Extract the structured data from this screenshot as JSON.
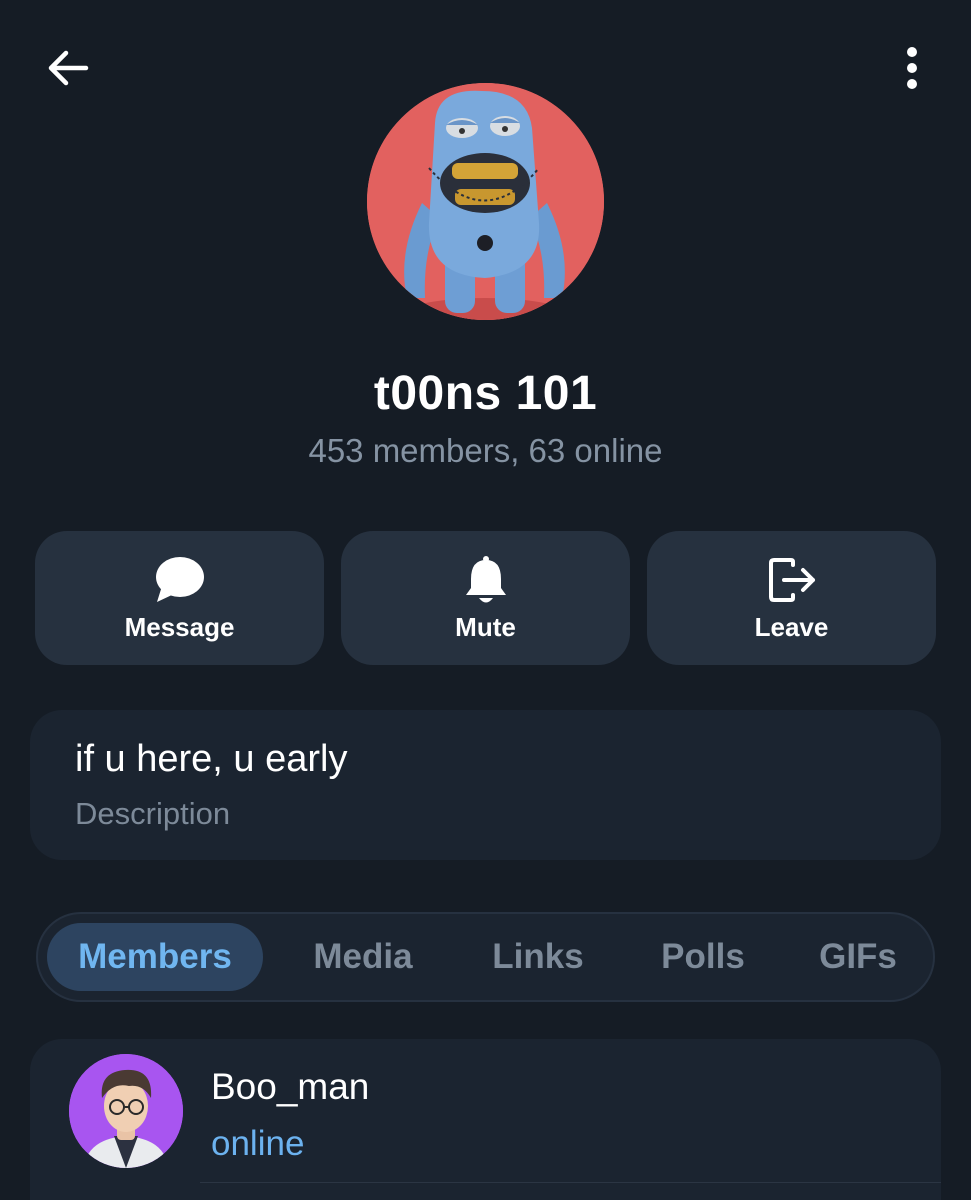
{
  "header": {
    "back_icon": "arrow-left-icon",
    "more_icon": "more-vertical-icon"
  },
  "group": {
    "avatar": "clay-monster-avatar",
    "title": "t00ns 101",
    "subtitle": "453 members, 63 online"
  },
  "actions": [
    {
      "label": "Message",
      "icon": "chat-bubble-icon"
    },
    {
      "label": "Mute",
      "icon": "bell-icon"
    },
    {
      "label": "Leave",
      "icon": "leave-icon"
    }
  ],
  "description": {
    "text": "if u here, u early",
    "label": "Description"
  },
  "tabs": [
    {
      "label": "Members",
      "active": true
    },
    {
      "label": "Media",
      "active": false
    },
    {
      "label": "Links",
      "active": false
    },
    {
      "label": "Polls",
      "active": false
    },
    {
      "label": "GIFs",
      "active": false
    }
  ],
  "members": [
    {
      "name": "Boo_man",
      "status": "online",
      "avatar": "cartoon-boy-avatar"
    }
  ],
  "colors": {
    "background": "#151c25",
    "card": "#1b2430",
    "button": "#26313f",
    "accent": "#70b6f0",
    "muted_text": "#7d8a99",
    "online": "#6cb2ef"
  }
}
